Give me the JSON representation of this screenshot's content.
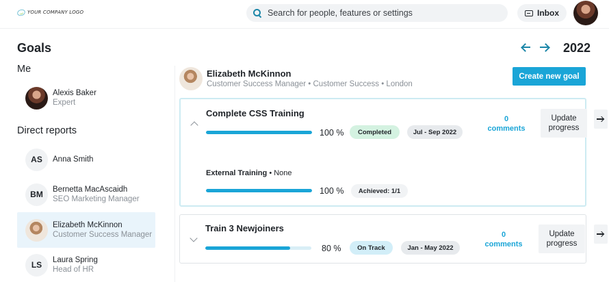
{
  "header": {
    "logo_text": "YOUR COMPANY LOGO",
    "search_placeholder": "Search for people, features or settings",
    "inbox_label": "Inbox"
  },
  "page": {
    "title": "Goals",
    "year": "2022"
  },
  "sidebar": {
    "me_label": "Me",
    "me": {
      "name": "Alexis Baker",
      "role": "Expert"
    },
    "direct_reports_label": "Direct reports",
    "reports": [
      {
        "initials": "AS",
        "name": "Anna Smith",
        "role": ""
      },
      {
        "initials": "BM",
        "name": "Bernetta MacAscaidh",
        "role": "SEO Marketing Manager"
      },
      {
        "initials": "",
        "name": "Elizabeth McKinnon",
        "role": "Customer Success Manager",
        "active": true
      },
      {
        "initials": "LS",
        "name": "Laura Spring",
        "role": "Head of HR"
      }
    ]
  },
  "employee": {
    "name": "Elizabeth McKinnon",
    "subtitle": "Customer Success Manager • Customer Success • London"
  },
  "actions": {
    "create_goal_label": "Create new goal"
  },
  "goals": [
    {
      "title": "Complete CSS Training",
      "progress": 100,
      "progress_text": "100 %",
      "status": "Completed",
      "period": "Jul - Sep 2022",
      "comments_count": "0",
      "comments_label": "comments",
      "update_label_1": "Update",
      "update_label_2": "progress",
      "expanded": true,
      "sub_item": {
        "name": "External Training",
        "detail": "• None",
        "progress": 100,
        "progress_text": "100 %",
        "achieved": "Achieved: 1/1"
      }
    },
    {
      "title": "Train 3 Newjoiners",
      "progress": 80,
      "progress_text": "80 %",
      "status": "On Track",
      "period": "Jan - May 2022",
      "comments_count": "0",
      "comments_label": "comments",
      "update_label_1": "Update",
      "update_label_2": "progress",
      "expanded": false
    }
  ],
  "colors": {
    "accent": "#1aa5d7",
    "completed_badge": "#d4f2e1",
    "on_track_badge": "#d2eef8",
    "active_row": "#e9f4fb"
  }
}
